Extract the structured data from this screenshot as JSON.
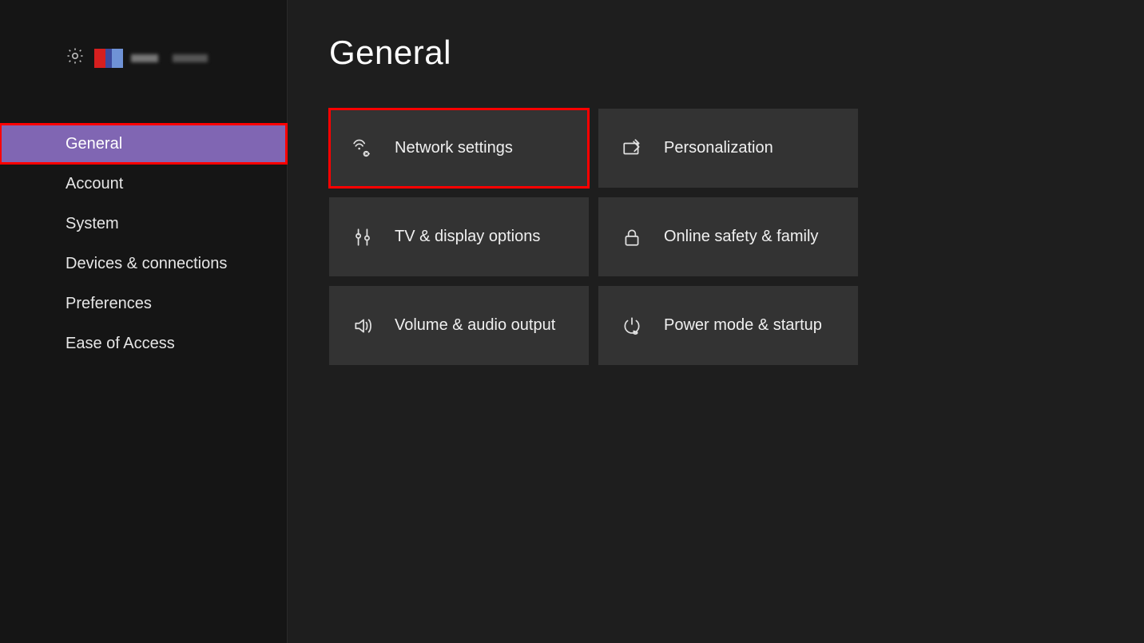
{
  "sidebar": {
    "items": [
      {
        "label": "General",
        "selected": true
      },
      {
        "label": "Account",
        "selected": false
      },
      {
        "label": "System",
        "selected": false
      },
      {
        "label": "Devices & connections",
        "selected": false
      },
      {
        "label": "Preferences",
        "selected": false
      },
      {
        "label": "Ease of Access",
        "selected": false
      }
    ]
  },
  "main": {
    "title": "General",
    "tiles": [
      {
        "label": "Network settings",
        "icon": "network-icon",
        "highlighted": true
      },
      {
        "label": "Personalization",
        "icon": "personalization-icon",
        "highlighted": false
      },
      {
        "label": "TV & display options",
        "icon": "display-icon",
        "highlighted": false
      },
      {
        "label": "Online safety & family",
        "icon": "lock-icon",
        "highlighted": false
      },
      {
        "label": "Volume & audio output",
        "icon": "audio-icon",
        "highlighted": false
      },
      {
        "label": "Power mode & startup",
        "icon": "power-icon",
        "highlighted": false
      }
    ]
  }
}
